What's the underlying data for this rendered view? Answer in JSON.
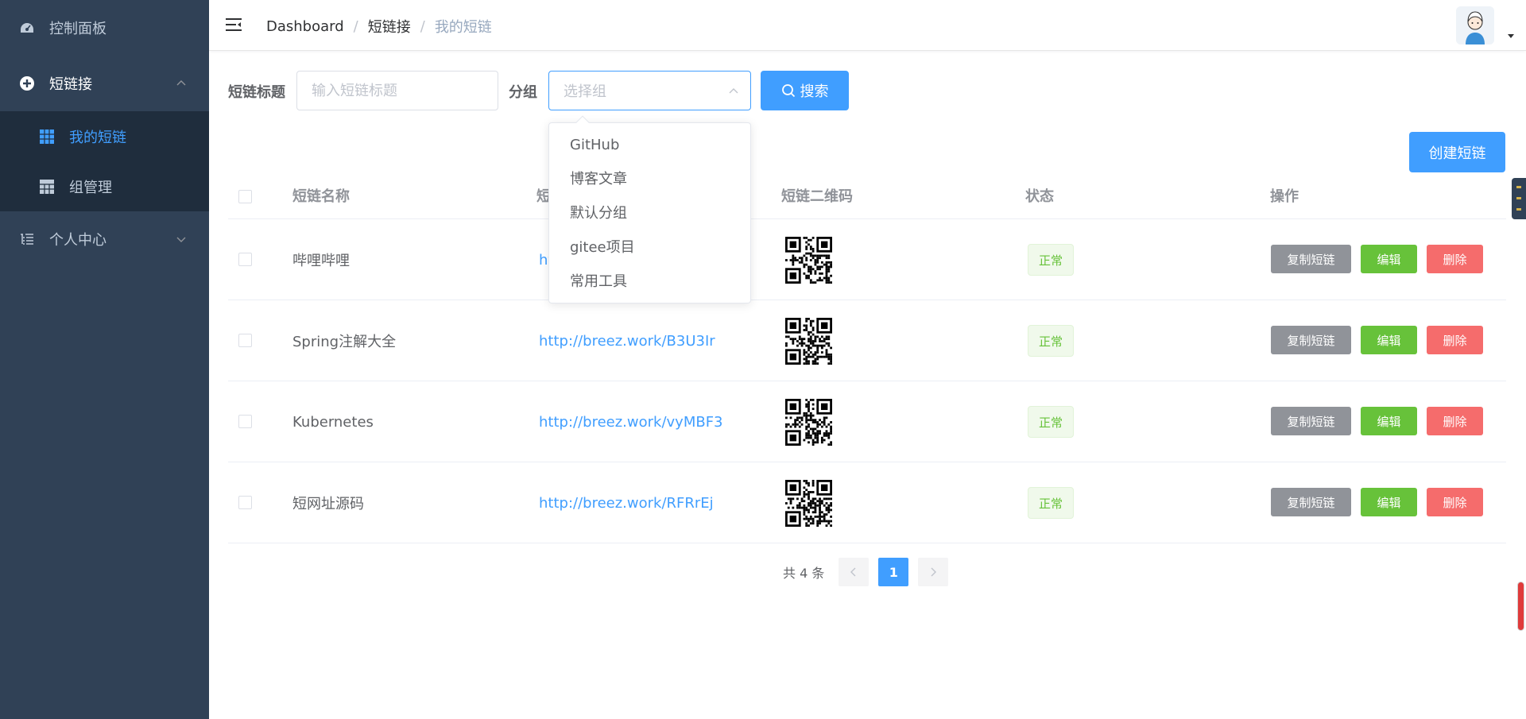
{
  "sidebar": {
    "dashboard": "控制面板",
    "shortlink_group": "短链接",
    "my_links": "我的短链",
    "group_manage": "组管理",
    "personal_center": "个人中心"
  },
  "breadcrumb": [
    "Dashboard",
    "短链接",
    "我的短链"
  ],
  "search": {
    "title_label": "短链标题",
    "title_placeholder": "输入短链标题",
    "group_label": "分组",
    "group_placeholder": "选择组",
    "search_button": "搜索"
  },
  "dropdown_options": [
    "GitHub",
    "博客文章",
    "默认分组",
    "gitee项目",
    "常用工具"
  ],
  "create_button": "创建短链",
  "table": {
    "headers": {
      "name": "短链名称",
      "url": "短链",
      "qrcode": "短链二维码",
      "status": "状态",
      "actions": "操作"
    },
    "rows": [
      {
        "name": "哔哩哔哩",
        "url": "ht",
        "status": "正常"
      },
      {
        "name": "Spring注解大全",
        "url": "http://breez.work/B3U3Ir",
        "status": "正常"
      },
      {
        "name": "Kubernetes",
        "url": "http://breez.work/vyMBF3",
        "status": "正常"
      },
      {
        "name": "短网址源码",
        "url": "http://breez.work/RFRrEj",
        "status": "正常"
      }
    ],
    "action_labels": {
      "copy": "复制短链",
      "edit": "编辑",
      "delete": "删除"
    }
  },
  "pagination": {
    "total": "共 4 条",
    "current_page": "1"
  },
  "colors": {
    "primary": "#409eff",
    "success": "#67c23a",
    "danger": "#f56c6c",
    "info": "#909399",
    "sidebar": "#304156"
  }
}
